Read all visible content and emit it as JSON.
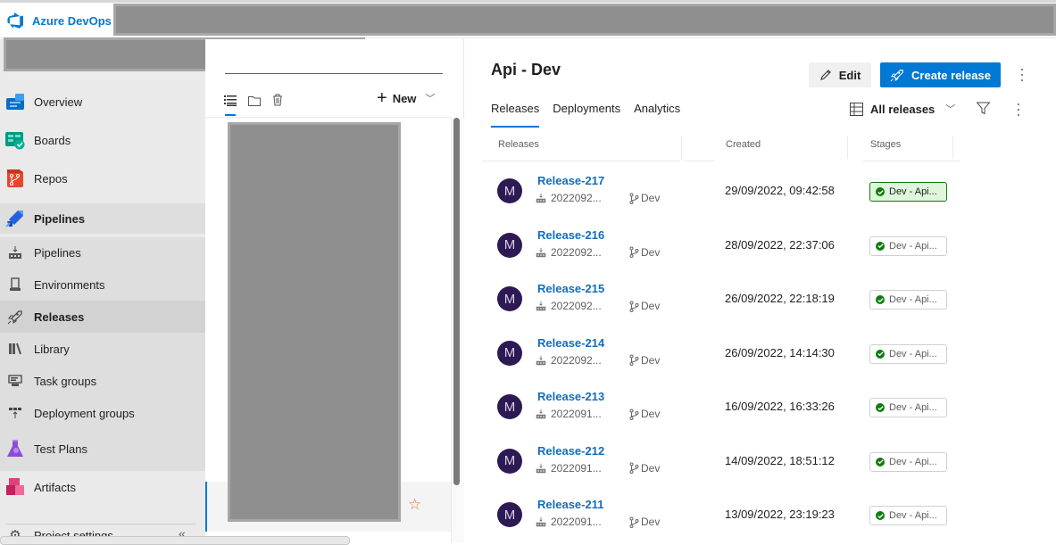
{
  "header": {
    "app_name": "Azure DevOps"
  },
  "sidebar": {
    "items": [
      {
        "label": "Overview",
        "icon": "overview-icon"
      },
      {
        "label": "Boards",
        "icon": "boards-icon"
      },
      {
        "label": "Repos",
        "icon": "repos-icon"
      },
      {
        "label": "Pipelines",
        "icon": "pipelines-hub-icon"
      },
      {
        "label": "Pipelines",
        "icon": "pipelines-icon"
      },
      {
        "label": "Environments",
        "icon": "environments-icon"
      },
      {
        "label": "Releases",
        "icon": "releases-icon"
      },
      {
        "label": "Library",
        "icon": "library-icon"
      },
      {
        "label": "Task groups",
        "icon": "task-groups-icon"
      },
      {
        "label": "Deployment groups",
        "icon": "deployment-groups-icon"
      },
      {
        "label": "Test Plans",
        "icon": "test-plans-icon"
      },
      {
        "label": "Artifacts",
        "icon": "artifacts-icon"
      }
    ],
    "footer": {
      "label": "Project settings",
      "collapse_glyph": "«"
    }
  },
  "definitions_panel": {
    "new_label": "New",
    "favorite_glyph": "☆"
  },
  "main": {
    "title": "Api - Dev",
    "edit_label": "Edit",
    "create_release_label": "Create release",
    "tabs": [
      {
        "label": "Releases",
        "active": true
      },
      {
        "label": "Deployments",
        "active": false
      },
      {
        "label": "Analytics",
        "active": false
      }
    ],
    "view_selector": "All releases",
    "columns": {
      "releases": "Releases",
      "created": "Created",
      "stages": "Stages"
    },
    "releases": [
      {
        "avatar": "M",
        "name": "Release-217",
        "build": "2022092...",
        "branch": "Dev",
        "created": "29/09/2022, 09:42:58",
        "stage": "Dev - Api...",
        "stage_status": "succeeded"
      },
      {
        "avatar": "M",
        "name": "Release-216",
        "build": "2022092...",
        "branch": "Dev",
        "created": "28/09/2022, 22:37:06",
        "stage": "Dev - Api...",
        "stage_status": "succeeded"
      },
      {
        "avatar": "M",
        "name": "Release-215",
        "build": "2022092...",
        "branch": "Dev",
        "created": "26/09/2022, 22:18:19",
        "stage": "Dev - Api...",
        "stage_status": "succeeded"
      },
      {
        "avatar": "M",
        "name": "Release-214",
        "build": "2022092...",
        "branch": "Dev",
        "created": "26/09/2022, 14:14:30",
        "stage": "Dev - Api...",
        "stage_status": "succeeded"
      },
      {
        "avatar": "M",
        "name": "Release-213",
        "build": "2022091...",
        "branch": "Dev",
        "created": "16/09/2022, 16:33:26",
        "stage": "Dev - Api...",
        "stage_status": "succeeded"
      },
      {
        "avatar": "M",
        "name": "Release-212",
        "build": "2022091...",
        "branch": "Dev",
        "created": "14/09/2022, 18:51:12",
        "stage": "Dev - Api...",
        "stage_status": "succeeded"
      },
      {
        "avatar": "M",
        "name": "Release-211",
        "build": "2022091...",
        "branch": "Dev",
        "created": "13/09/2022, 23:19:23",
        "stage": "Dev - Api...",
        "stage_status": "succeeded"
      }
    ]
  },
  "colors": {
    "accent": "#0078d4",
    "link": "#106ebe",
    "avatar": "#2d1a54",
    "success": "#107c10",
    "success_bg": "#dff6dd"
  }
}
